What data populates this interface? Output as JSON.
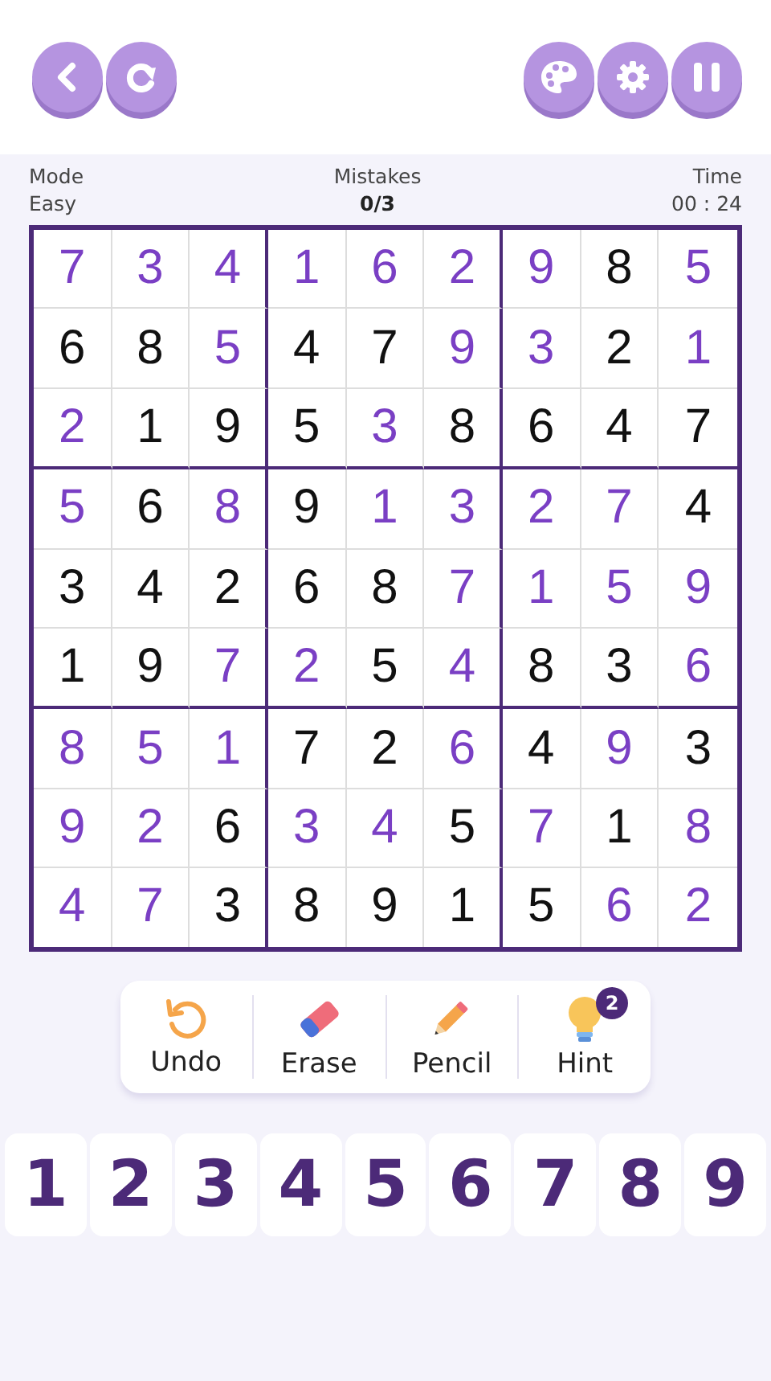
{
  "toolbar_left": [
    {
      "kind": "back"
    },
    {
      "kind": "restart"
    }
  ],
  "toolbar_right": [
    {
      "kind": "theme"
    },
    {
      "kind": "settings"
    },
    {
      "kind": "pause"
    }
  ],
  "status": {
    "mode_label": "Mode",
    "mode": "Easy",
    "mistakes_label": "Mistakes",
    "mistakes": "0/3",
    "time_label": "Time",
    "time": "00 : 24"
  },
  "grid": [
    [
      {
        "value": "7",
        "kind": "entered"
      },
      {
        "value": "3",
        "kind": "entered"
      },
      {
        "value": "4",
        "kind": "entered"
      },
      {
        "value": "1",
        "kind": "entered"
      },
      {
        "value": "6",
        "kind": "entered"
      },
      {
        "value": "2",
        "kind": "entered"
      },
      {
        "value": "9",
        "kind": "entered"
      },
      {
        "value": "8",
        "kind": "given"
      },
      {
        "value": "5",
        "kind": "entered"
      }
    ],
    [
      {
        "value": "6",
        "kind": "given"
      },
      {
        "value": "8",
        "kind": "given"
      },
      {
        "value": "5",
        "kind": "entered"
      },
      {
        "value": "4",
        "kind": "given"
      },
      {
        "value": "7",
        "kind": "given"
      },
      {
        "value": "9",
        "kind": "entered"
      },
      {
        "value": "3",
        "kind": "entered"
      },
      {
        "value": "2",
        "kind": "given"
      },
      {
        "value": "1",
        "kind": "entered"
      }
    ],
    [
      {
        "value": "2",
        "kind": "entered"
      },
      {
        "value": "1",
        "kind": "given"
      },
      {
        "value": "9",
        "kind": "given"
      },
      {
        "value": "5",
        "kind": "given"
      },
      {
        "value": "3",
        "kind": "entered"
      },
      {
        "value": "8",
        "kind": "given"
      },
      {
        "value": "6",
        "kind": "given"
      },
      {
        "value": "4",
        "kind": "given"
      },
      {
        "value": "7",
        "kind": "given"
      }
    ],
    [
      {
        "value": "5",
        "kind": "entered"
      },
      {
        "value": "6",
        "kind": "given"
      },
      {
        "value": "8",
        "kind": "entered"
      },
      {
        "value": "9",
        "kind": "given"
      },
      {
        "value": "1",
        "kind": "entered"
      },
      {
        "value": "3",
        "kind": "entered"
      },
      {
        "value": "2",
        "kind": "entered"
      },
      {
        "value": "7",
        "kind": "entered"
      },
      {
        "value": "4",
        "kind": "given"
      }
    ],
    [
      {
        "value": "3",
        "kind": "given"
      },
      {
        "value": "4",
        "kind": "given"
      },
      {
        "value": "2",
        "kind": "given"
      },
      {
        "value": "6",
        "kind": "given"
      },
      {
        "value": "8",
        "kind": "given"
      },
      {
        "value": "7",
        "kind": "entered"
      },
      {
        "value": "1",
        "kind": "entered"
      },
      {
        "value": "5",
        "kind": "entered"
      },
      {
        "value": "9",
        "kind": "entered"
      }
    ],
    [
      {
        "value": "1",
        "kind": "given"
      },
      {
        "value": "9",
        "kind": "given"
      },
      {
        "value": "7",
        "kind": "entered"
      },
      {
        "value": "2",
        "kind": "entered"
      },
      {
        "value": "5",
        "kind": "given"
      },
      {
        "value": "4",
        "kind": "entered"
      },
      {
        "value": "8",
        "kind": "given"
      },
      {
        "value": "3",
        "kind": "given"
      },
      {
        "value": "6",
        "kind": "entered"
      }
    ],
    [
      {
        "value": "8",
        "kind": "entered"
      },
      {
        "value": "5",
        "kind": "entered"
      },
      {
        "value": "1",
        "kind": "entered"
      },
      {
        "value": "7",
        "kind": "given"
      },
      {
        "value": "2",
        "kind": "given"
      },
      {
        "value": "6",
        "kind": "entered"
      },
      {
        "value": "4",
        "kind": "given"
      },
      {
        "value": "9",
        "kind": "entered"
      },
      {
        "value": "3",
        "kind": "given"
      }
    ],
    [
      {
        "value": "9",
        "kind": "entered"
      },
      {
        "value": "2",
        "kind": "entered"
      },
      {
        "value": "6",
        "kind": "given"
      },
      {
        "value": "3",
        "kind": "entered"
      },
      {
        "value": "4",
        "kind": "entered"
      },
      {
        "value": "5",
        "kind": "given"
      },
      {
        "value": "7",
        "kind": "entered"
      },
      {
        "value": "1",
        "kind": "given"
      },
      {
        "value": "8",
        "kind": "entered"
      }
    ],
    [
      {
        "value": "4",
        "kind": "entered"
      },
      {
        "value": "7",
        "kind": "entered"
      },
      {
        "value": "3",
        "kind": "given"
      },
      {
        "value": "8",
        "kind": "given"
      },
      {
        "value": "9",
        "kind": "given"
      },
      {
        "value": "1",
        "kind": "given"
      },
      {
        "value": "5",
        "kind": "given"
      },
      {
        "value": "6",
        "kind": "entered"
      },
      {
        "value": "2",
        "kind": "entered"
      }
    ]
  ],
  "tools": [
    {
      "kind": "undo",
      "label": "Undo"
    },
    {
      "kind": "erase",
      "label": "Erase"
    },
    {
      "kind": "pencil",
      "label": "Pencil"
    },
    {
      "kind": "hint",
      "label": "Hint",
      "badge": "2"
    }
  ],
  "number_pad": [
    "1",
    "2",
    "3",
    "4",
    "5",
    "6",
    "7",
    "8",
    "9"
  ]
}
